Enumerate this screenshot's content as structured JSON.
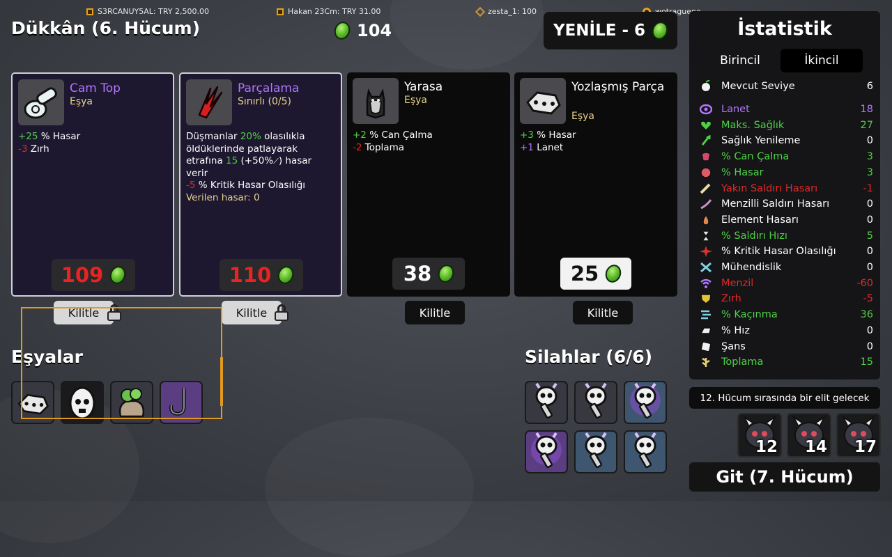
{
  "streamers": [
    {
      "label": "S3RCANUY5AL: TRY 2,500.00",
      "icon": "square-icon"
    },
    {
      "label": "Hakan 23Cm: TRY 31.00",
      "icon": "square-icon"
    },
    {
      "label": "zesta_1: 100",
      "icon": "diamond-icon"
    },
    {
      "label": "wotragueno",
      "icon": "ring-icon"
    }
  ],
  "shop": {
    "title": "Dükkân (6. Hücum)",
    "materials": "104",
    "reroll_label": "YENİLE - 6"
  },
  "cards": [
    {
      "name": "Cam Top",
      "type": "Eşya",
      "name_color": "#b276ff",
      "stats": [
        {
          "value": "+25",
          "label": " % Hasar"
        },
        {
          "value": "-3",
          "label": " Zırh"
        }
      ],
      "price": "109",
      "lock_label": "Kilitle",
      "locked": true
    },
    {
      "name": "Parçalama",
      "type": "Sınırlı (0/5)",
      "name_color": "#b276ff",
      "desc": {
        "l1a": "Düşmanlar ",
        "l1b": "20%",
        "l1c": " olasılıkla",
        "l2": "öldüklerinde patlayarak",
        "l3a": "etrafına ",
        "l3b": "15",
        "l3c": " (+50%",
        "l3d": ") hasar",
        "l4": "verir",
        "l5a": "-5",
        "l5b": " % Kritik Hasar Olasılığı",
        "l6": "Verilen hasar: 0"
      },
      "price": "110",
      "lock_label": "Kilitle",
      "locked": true
    },
    {
      "name": "Yarasa",
      "type": "Eşya",
      "name_color": "#ffffff",
      "stats": [
        {
          "value": "+2",
          "label": " % Can Çalma"
        },
        {
          "value": "-2",
          "label": " Toplama"
        }
      ],
      "price": "38",
      "lock_label": "Kilitle",
      "locked": false
    },
    {
      "name": "Yozlaşmış Parça",
      "type": "Eşya",
      "name_color": "#ffffff",
      "stats": [
        {
          "value": "+3",
          "label": " % Hasar"
        },
        {
          "value": "+1",
          "label": " Lanet"
        }
      ],
      "price": "25",
      "lock_label": "Kilitle",
      "locked": false
    }
  ],
  "items_title": "Eşyalar",
  "weapons_title": "Silahlar (6/6)",
  "stats": {
    "title": "İstatistik",
    "tab_primary": "Birincil",
    "tab_secondary": "İkincil",
    "level": {
      "name": "Mevcut Seviye",
      "value": "6"
    },
    "rows": [
      {
        "name": "Lanet",
        "value": "18",
        "color": "#b276ff",
        "icon": "curse-icon"
      },
      {
        "name": "Maks. Sağlık",
        "value": "27",
        "color": "#4ed046",
        "icon": "heart-icon"
      },
      {
        "name": "Sağlık Yenileme",
        "value": "0",
        "color": "#ffffff",
        "icon": "regen-icon"
      },
      {
        "name": "% Can Çalma",
        "value": "3",
        "color": "#4ed046",
        "icon": "lifesteal-icon"
      },
      {
        "name": "% Hasar",
        "value": "3",
        "color": "#4ed046",
        "icon": "damage-icon"
      },
      {
        "name": "Yakın Saldırı Hasarı",
        "value": "-1",
        "color": "#e02929",
        "icon": "melee-icon"
      },
      {
        "name": "Menzilli Saldırı Hasarı",
        "value": "0",
        "color": "#ffffff",
        "icon": "ranged-icon"
      },
      {
        "name": "Element Hasarı",
        "value": "0",
        "color": "#ffffff",
        "icon": "elemental-icon"
      },
      {
        "name": "% Saldırı Hızı",
        "value": "5",
        "color": "#4ed046",
        "icon": "attack-speed-icon"
      },
      {
        "name": "% Kritik Hasar Olasılığı",
        "value": "0",
        "color": "#ffffff",
        "icon": "crit-icon"
      },
      {
        "name": "Mühendislik",
        "value": "0",
        "color": "#ffffff",
        "icon": "engineering-icon"
      },
      {
        "name": "Menzil",
        "value": "-60",
        "color": "#e02929",
        "icon": "range-icon"
      },
      {
        "name": "Zırh",
        "value": "-5",
        "color": "#e02929",
        "icon": "armor-icon"
      },
      {
        "name": "% Kaçınma",
        "value": "36",
        "color": "#4ed046",
        "icon": "dodge-icon"
      },
      {
        "name": "% Hız",
        "value": "0",
        "color": "#ffffff",
        "icon": "speed-icon"
      },
      {
        "name": "Şans",
        "value": "0",
        "color": "#ffffff",
        "icon": "luck-icon"
      },
      {
        "name": "Toplama",
        "value": "15",
        "color": "#4ed046",
        "icon": "harvesting-icon"
      }
    ]
  },
  "elite_note": "12. Hücum sırasında bir elit gelecek",
  "elites": [
    "12",
    "14",
    "17"
  ],
  "go_label": "Git (7. Hücum)"
}
